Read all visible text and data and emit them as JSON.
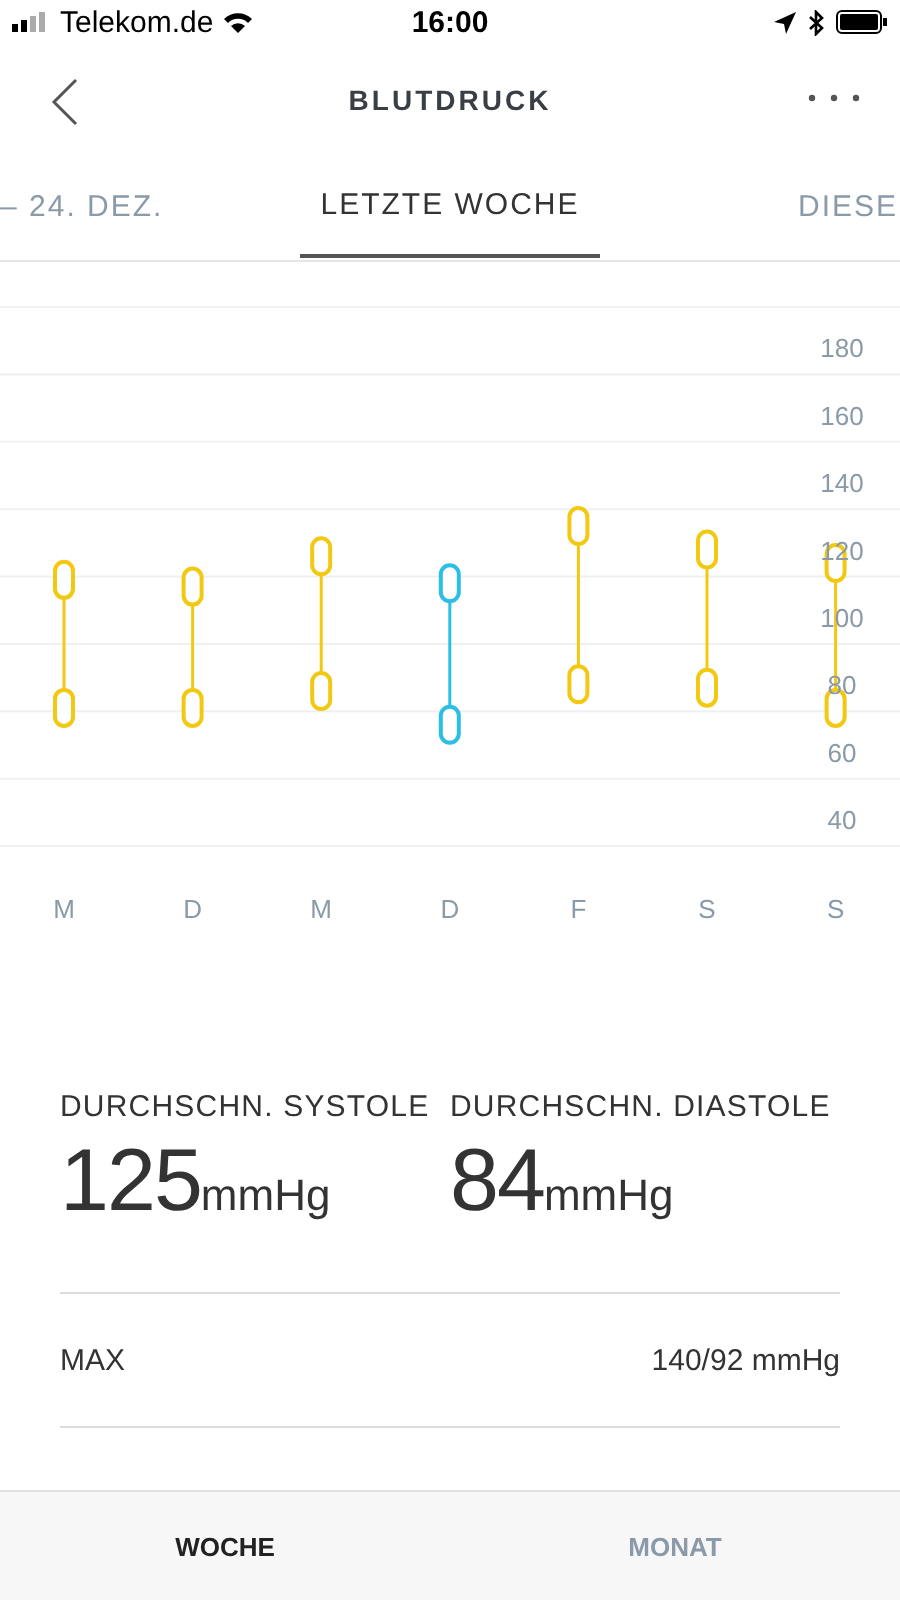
{
  "status_bar": {
    "carrier": "Telekom.de",
    "time": "16:00"
  },
  "header": {
    "title": "BLUTDRUCK"
  },
  "tabs": [
    {
      "label": "– 24. DEZ.",
      "selected": false
    },
    {
      "label": "LETZTE WOCHE",
      "selected": true
    },
    {
      "label": "DIESE",
      "selected": false
    }
  ],
  "chart": {
    "chart_data": {
      "type": "scatter",
      "categories": [
        "M",
        "D",
        "M",
        "D",
        "F",
        "S",
        "S"
      ],
      "series": [
        {
          "color": "#f2c811",
          "values": [
            119,
            117,
            126,
            null,
            135,
            128,
            124
          ]
        },
        {
          "color": "#f2c811",
          "values": [
            81,
            81,
            86,
            null,
            88,
            87,
            81
          ]
        },
        {
          "color": "#2bbfe6",
          "values": [
            null,
            null,
            null,
            118,
            null,
            null,
            null
          ]
        },
        {
          "color": "#2bbfe6",
          "values": [
            null,
            null,
            null,
            76,
            null,
            null,
            null
          ]
        }
      ],
      "ylim": [
        40,
        200
      ],
      "grid": true,
      "yticks": [
        40,
        60,
        80,
        100,
        120,
        140,
        160,
        180
      ]
    }
  },
  "stats": [
    {
      "label": "DURCHSCHN. SYSTOLE",
      "value": "125",
      "unit": "mmHg"
    },
    {
      "label": "DURCHSCHN. DIASTOLE",
      "value": "84",
      "unit": "mmHg"
    }
  ],
  "max": {
    "label": "MAX",
    "value": "140/92 mmHg"
  },
  "bottom_tabs": [
    {
      "label": "WOCHE",
      "selected": true
    },
    {
      "label": "MONAT",
      "selected": false
    }
  ]
}
